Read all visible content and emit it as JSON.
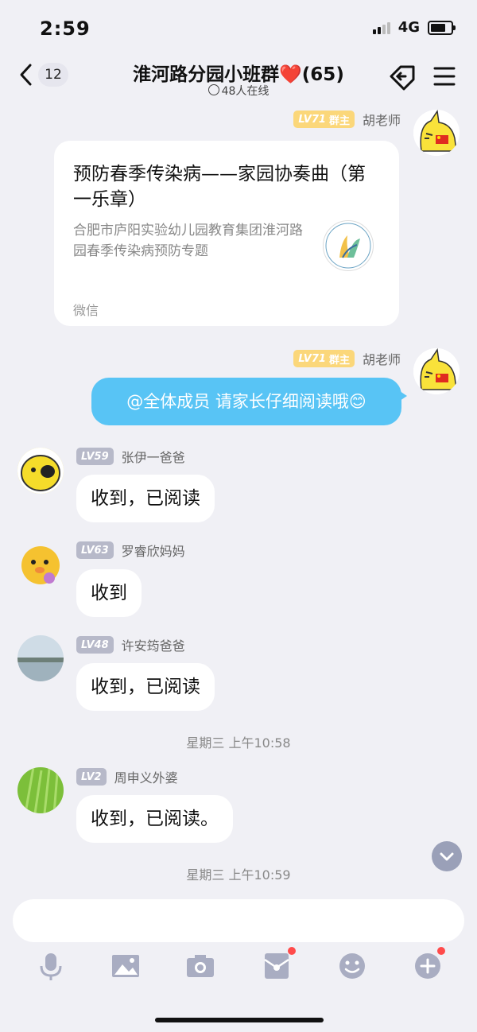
{
  "status_bar": {
    "time": "2:59",
    "network": "4G"
  },
  "header": {
    "unread_count": "12",
    "title": "淮河路分园小班群❤️(65)",
    "online": "48人在线"
  },
  "messages": [
    {
      "sender": "胡老师",
      "level": "LV71",
      "role": "群主",
      "side": "right",
      "type": "card",
      "card": {
        "title": "预防春季传染病——家园协奏曲（第一乐章）",
        "description": "合肥市庐阳实验幼儿园教育集团淮河路园春季传染病预防专题",
        "source": "微信"
      }
    },
    {
      "sender": "胡老师",
      "level": "LV71",
      "role": "群主",
      "side": "right",
      "text": "@全体成员 请家长仔细阅读哦😊"
    },
    {
      "sender": "张伊一爸爸",
      "level": "LV59",
      "side": "left",
      "text": "收到，已阅读"
    },
    {
      "sender": "罗睿欣妈妈",
      "level": "LV63",
      "side": "left",
      "text": "收到"
    },
    {
      "sender": "许安筠爸爸",
      "level": "LV48",
      "side": "left",
      "text": "收到，已阅读"
    },
    {
      "sender": "周申义外婆",
      "level": "LV2",
      "side": "left",
      "text": "收到，已阅读。"
    }
  ],
  "time_separators": [
    "星期三 上午10:58",
    "星期三 上午10:59"
  ],
  "toolbar_icons": [
    "microphone-icon",
    "image-icon",
    "camera-icon",
    "red-packet-icon",
    "emoji-icon",
    "plus-icon"
  ],
  "colors": {
    "accent_blue": "#58c4f5",
    "owner_badge": "#fbd77a",
    "level_badge": "#b7b9c9",
    "notify_dot": "#ff4b4b"
  }
}
